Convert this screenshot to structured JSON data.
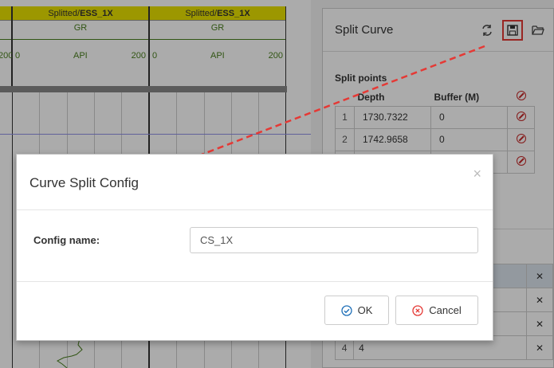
{
  "tracks": [
    {
      "title_prefix": "Splitted/",
      "title_well": "ESS_1X",
      "curve": "GR",
      "scale_min": "0",
      "scale_unit": "API",
      "scale_max": "200"
    },
    {
      "title_prefix": "Splitted/",
      "title_well": "ESS_1X",
      "curve": "GR",
      "scale_min": "0",
      "scale_unit": "API",
      "scale_max": "200"
    }
  ],
  "left_track": {
    "scale_max": "200"
  },
  "panel": {
    "title": "Split Curve",
    "icons": [
      "refresh-icon",
      "save-icon",
      "folder-open-icon"
    ],
    "split_points_title": "Split points",
    "columns": {
      "depth": "Depth",
      "buffer": "Buffer (M)"
    },
    "rows": [
      {
        "idx": "1",
        "depth": "1730.7322",
        "buffer": "0"
      },
      {
        "idx": "2",
        "depth": "1742.9658",
        "buffer": "0"
      },
      {
        "idx": "",
        "depth": "",
        "buffer": ""
      }
    ],
    "lower_rows": [
      {
        "idx": "",
        "value": ""
      },
      {
        "idx": "",
        "value": ""
      },
      {
        "idx": "",
        "value": ""
      },
      {
        "idx": "4",
        "value": "4"
      }
    ]
  },
  "dialog": {
    "title": "Curve Split Config",
    "close": "×",
    "label": "Config name:",
    "value": "CS_1X",
    "ok": "OK",
    "cancel": "Cancel"
  },
  "colors": {
    "accent_red": "#e53935",
    "track_title": "#e9e200",
    "curve_green": "#4a7f1e"
  }
}
